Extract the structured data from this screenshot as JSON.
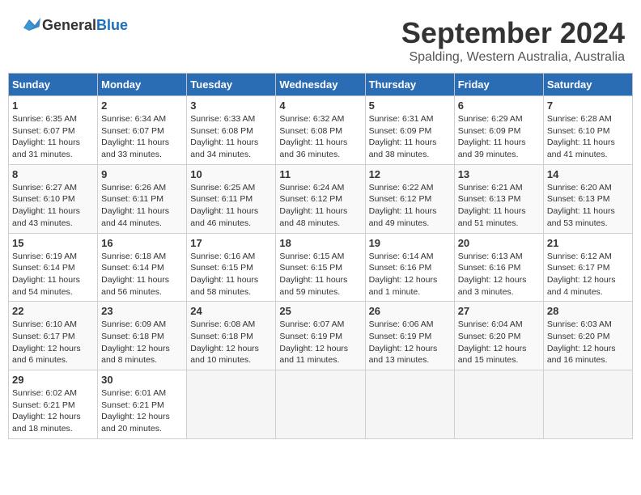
{
  "header": {
    "logo_general": "General",
    "logo_blue": "Blue",
    "month_title": "September 2024",
    "location": "Spalding, Western Australia, Australia"
  },
  "days_of_week": [
    "Sunday",
    "Monday",
    "Tuesday",
    "Wednesday",
    "Thursday",
    "Friday",
    "Saturday"
  ],
  "weeks": [
    [
      {
        "day": "1",
        "sunrise": "6:35 AM",
        "sunset": "6:07 PM",
        "daylight": "11 hours and 31 minutes."
      },
      {
        "day": "2",
        "sunrise": "6:34 AM",
        "sunset": "6:07 PM",
        "daylight": "11 hours and 33 minutes."
      },
      {
        "day": "3",
        "sunrise": "6:33 AM",
        "sunset": "6:08 PM",
        "daylight": "11 hours and 34 minutes."
      },
      {
        "day": "4",
        "sunrise": "6:32 AM",
        "sunset": "6:08 PM",
        "daylight": "11 hours and 36 minutes."
      },
      {
        "day": "5",
        "sunrise": "6:31 AM",
        "sunset": "6:09 PM",
        "daylight": "11 hours and 38 minutes."
      },
      {
        "day": "6",
        "sunrise": "6:29 AM",
        "sunset": "6:09 PM",
        "daylight": "11 hours and 39 minutes."
      },
      {
        "day": "7",
        "sunrise": "6:28 AM",
        "sunset": "6:10 PM",
        "daylight": "11 hours and 41 minutes."
      }
    ],
    [
      {
        "day": "8",
        "sunrise": "6:27 AM",
        "sunset": "6:10 PM",
        "daylight": "11 hours and 43 minutes."
      },
      {
        "day": "9",
        "sunrise": "6:26 AM",
        "sunset": "6:11 PM",
        "daylight": "11 hours and 44 minutes."
      },
      {
        "day": "10",
        "sunrise": "6:25 AM",
        "sunset": "6:11 PM",
        "daylight": "11 hours and 46 minutes."
      },
      {
        "day": "11",
        "sunrise": "6:24 AM",
        "sunset": "6:12 PM",
        "daylight": "11 hours and 48 minutes."
      },
      {
        "day": "12",
        "sunrise": "6:22 AM",
        "sunset": "6:12 PM",
        "daylight": "11 hours and 49 minutes."
      },
      {
        "day": "13",
        "sunrise": "6:21 AM",
        "sunset": "6:13 PM",
        "daylight": "11 hours and 51 minutes."
      },
      {
        "day": "14",
        "sunrise": "6:20 AM",
        "sunset": "6:13 PM",
        "daylight": "11 hours and 53 minutes."
      }
    ],
    [
      {
        "day": "15",
        "sunrise": "6:19 AM",
        "sunset": "6:14 PM",
        "daylight": "11 hours and 54 minutes."
      },
      {
        "day": "16",
        "sunrise": "6:18 AM",
        "sunset": "6:14 PM",
        "daylight": "11 hours and 56 minutes."
      },
      {
        "day": "17",
        "sunrise": "6:16 AM",
        "sunset": "6:15 PM",
        "daylight": "11 hours and 58 minutes."
      },
      {
        "day": "18",
        "sunrise": "6:15 AM",
        "sunset": "6:15 PM",
        "daylight": "11 hours and 59 minutes."
      },
      {
        "day": "19",
        "sunrise": "6:14 AM",
        "sunset": "6:16 PM",
        "daylight": "12 hours and 1 minute."
      },
      {
        "day": "20",
        "sunrise": "6:13 AM",
        "sunset": "6:16 PM",
        "daylight": "12 hours and 3 minutes."
      },
      {
        "day": "21",
        "sunrise": "6:12 AM",
        "sunset": "6:17 PM",
        "daylight": "12 hours and 4 minutes."
      }
    ],
    [
      {
        "day": "22",
        "sunrise": "6:10 AM",
        "sunset": "6:17 PM",
        "daylight": "12 hours and 6 minutes."
      },
      {
        "day": "23",
        "sunrise": "6:09 AM",
        "sunset": "6:18 PM",
        "daylight": "12 hours and 8 minutes."
      },
      {
        "day": "24",
        "sunrise": "6:08 AM",
        "sunset": "6:18 PM",
        "daylight": "12 hours and 10 minutes."
      },
      {
        "day": "25",
        "sunrise": "6:07 AM",
        "sunset": "6:19 PM",
        "daylight": "12 hours and 11 minutes."
      },
      {
        "day": "26",
        "sunrise": "6:06 AM",
        "sunset": "6:19 PM",
        "daylight": "12 hours and 13 minutes."
      },
      {
        "day": "27",
        "sunrise": "6:04 AM",
        "sunset": "6:20 PM",
        "daylight": "12 hours and 15 minutes."
      },
      {
        "day": "28",
        "sunrise": "6:03 AM",
        "sunset": "6:20 PM",
        "daylight": "12 hours and 16 minutes."
      }
    ],
    [
      {
        "day": "29",
        "sunrise": "6:02 AM",
        "sunset": "6:21 PM",
        "daylight": "12 hours and 18 minutes."
      },
      {
        "day": "30",
        "sunrise": "6:01 AM",
        "sunset": "6:21 PM",
        "daylight": "12 hours and 20 minutes."
      },
      null,
      null,
      null,
      null,
      null
    ]
  ],
  "labels": {
    "sunrise": "Sunrise: ",
    "sunset": "Sunset: ",
    "daylight": "Daylight: "
  }
}
